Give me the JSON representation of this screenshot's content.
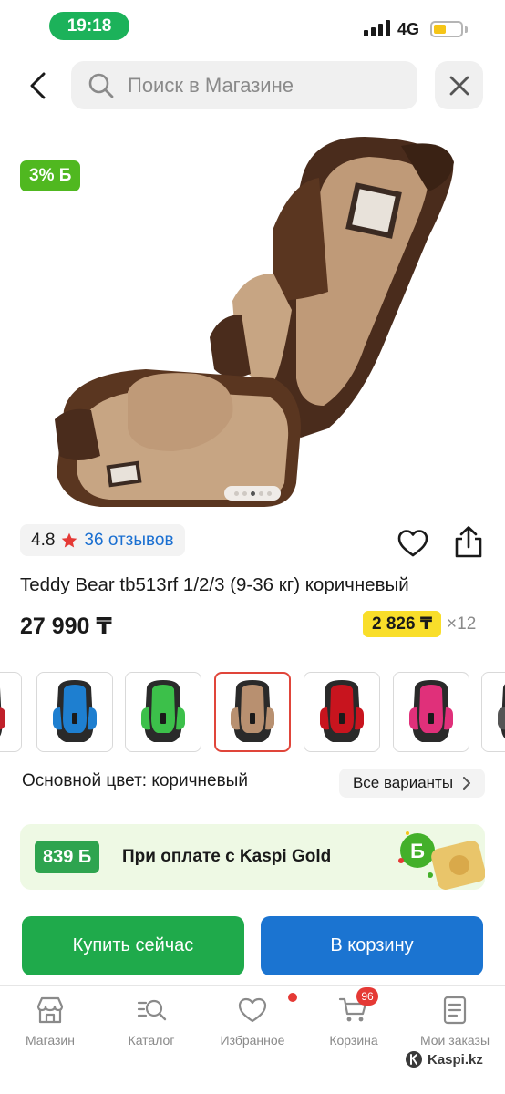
{
  "status_bar": {
    "time": "19:18",
    "network": "4G",
    "colors": {
      "time_pill": "#1cb25a",
      "battery": "#f5c518"
    }
  },
  "header": {
    "back_icon": "chevron-left-icon",
    "search_placeholder": "Поиск в Магазине",
    "clear_icon": "close-icon"
  },
  "product": {
    "discount_badge": "3% Б",
    "gallery": {
      "image_count": 5,
      "active_index": 2
    },
    "rating": "4.8",
    "reviews": "36 отзывов",
    "title": "Teddy Bear tb513rf 1/2/3 (9-36 кг) коричневый",
    "price": "27 990 ₸",
    "installment_amount": "2 826 ₸",
    "installment_count": "×12"
  },
  "variants": {
    "colors": [
      {
        "name": "red-partial",
        "color": "#c0202a"
      },
      {
        "name": "blue",
        "color": "#1e7fd0"
      },
      {
        "name": "green",
        "color": "#3cc04a"
      },
      {
        "name": "brown",
        "color": "#b89070"
      },
      {
        "name": "red",
        "color": "#c8141e"
      },
      {
        "name": "pink",
        "color": "#e0307a"
      },
      {
        "name": "grey-partial",
        "color": "#555555"
      }
    ],
    "selected": "brown",
    "main_color_label": "Основной цвет: коричневый",
    "all_variants_label": "Все варианты"
  },
  "kaspi_gold": {
    "bonus": "839 Б",
    "text": "При оплате с Kaspi Gold"
  },
  "actions": {
    "buy_now": "Купить сейчас",
    "add_to_cart": "В корзину"
  },
  "tab_bar": {
    "items": [
      {
        "label": "Магазин",
        "icon": "store-icon"
      },
      {
        "label": "Каталог",
        "icon": "catalog-search-icon"
      },
      {
        "label": "Избранное",
        "icon": "heart-icon"
      },
      {
        "label": "Корзина",
        "icon": "cart-icon",
        "badge": "96"
      },
      {
        "label": "Мои заказы",
        "icon": "orders-icon"
      }
    ]
  },
  "watermark": "Kaspi.kz"
}
